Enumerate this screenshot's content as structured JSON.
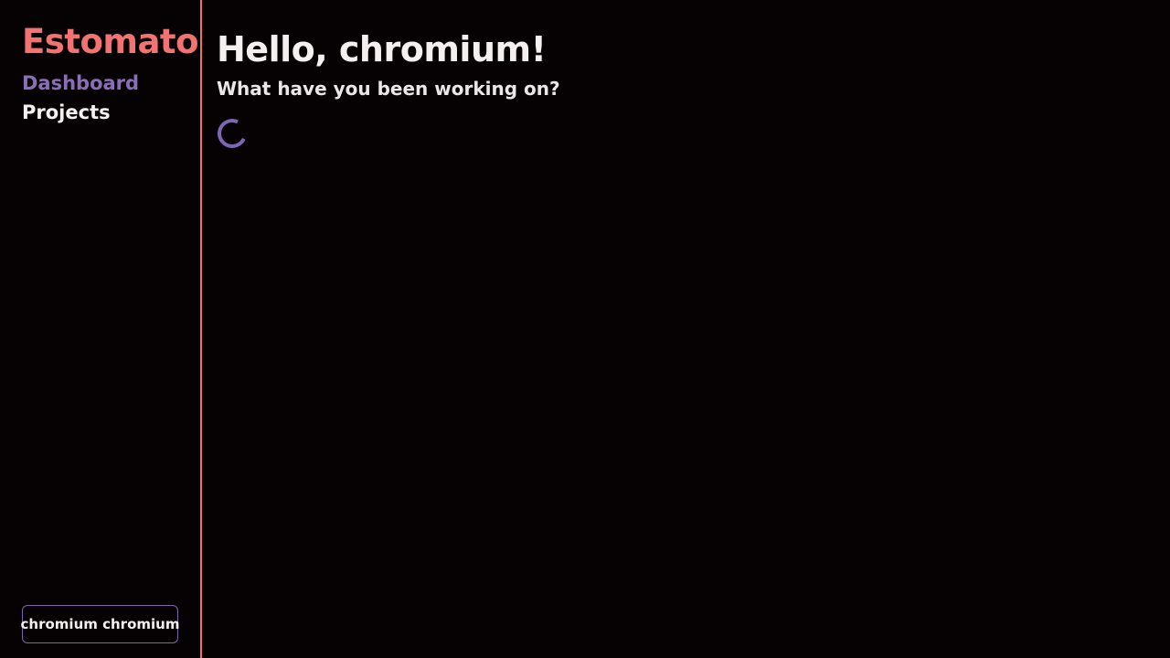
{
  "app": {
    "brand": "Estomato",
    "colors": {
      "accent": "#f37373",
      "active_nav": "#8a6fb8",
      "border_accent": "#f26d6d",
      "user_button_border": "#7d67aa",
      "spinner": "#7e66b5",
      "background": "#060203"
    }
  },
  "sidebar": {
    "nav": [
      {
        "label": "Dashboard",
        "active": true
      },
      {
        "label": "Projects",
        "active": false
      }
    ],
    "user_button_label": "chromium chromium"
  },
  "main": {
    "greeting": "Hello, chromium!",
    "subheading": "What have you been working on?",
    "loading_indicator": "spinner-icon"
  }
}
